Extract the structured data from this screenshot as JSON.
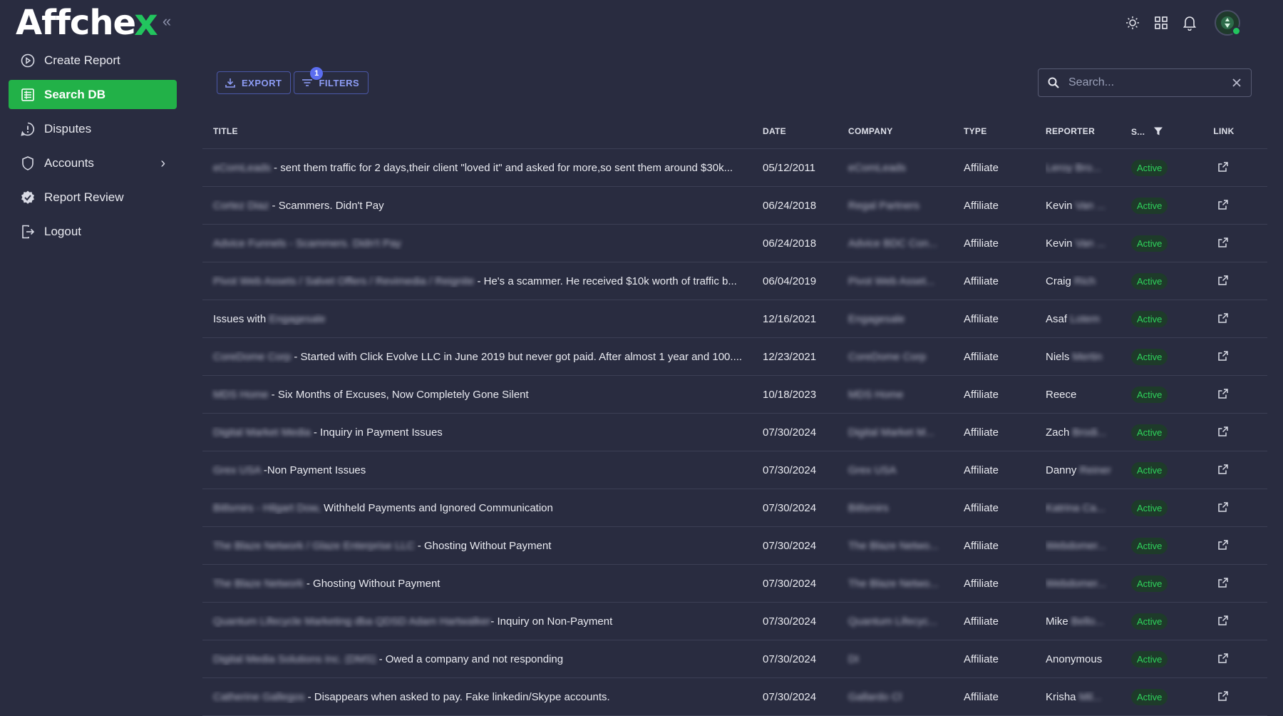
{
  "brand": {
    "logo_text": "Affche",
    "logo_x": "x",
    "collapse_icon": "«"
  },
  "sidebar": {
    "items": [
      {
        "label": "Create Report",
        "icon": "play-circle-icon"
      },
      {
        "label": "Search DB",
        "icon": "table-list-icon",
        "active": true
      },
      {
        "label": "Disputes",
        "icon": "alert-circle-icon"
      },
      {
        "label": "Accounts",
        "icon": "shield-icon",
        "has_chevron": true
      },
      {
        "label": "Report Review",
        "icon": "verified-badge-icon"
      },
      {
        "label": "Logout",
        "icon": "logout-icon"
      }
    ],
    "chevron": "›"
  },
  "topbar": {
    "icons": [
      "sun-icon",
      "grid-icon",
      "bell-icon",
      "avatar"
    ]
  },
  "toolbar": {
    "export_label": "EXPORT",
    "filters_label": "FILTERS",
    "filters_count": "1"
  },
  "search": {
    "placeholder": "Search...",
    "value": ""
  },
  "table": {
    "headers": {
      "title": "TITLE",
      "date": "DATE",
      "company": "COMPANY",
      "type": "TYPE",
      "reporter": "REPORTER",
      "status": "S...",
      "link": "LINK"
    },
    "rows": [
      {
        "title_blur": "eComLeads",
        "title": " - sent them traffic for 2 days,their client \"loved it\" and asked for more,so sent them around $30k...",
        "date": "05/12/2011",
        "company": "eComLeads",
        "type": "Affiliate",
        "reporter": "",
        "reporter_blur": "Leroy Bro...",
        "status": "Active"
      },
      {
        "title_blur": "Cortez Diaz",
        "title": " - Scammers. Didn't Pay",
        "date": "06/24/2018",
        "company": "Regal Partners",
        "type": "Affiliate",
        "reporter": "Kevin ",
        "reporter_blur": "Van ...",
        "status": "Active"
      },
      {
        "title_blur": "Advice Funnels - Scammers. Didn't Pay",
        "title": "",
        "date": "06/24/2018",
        "company": "Advice BDC Con...",
        "type": "Affiliate",
        "reporter": "Kevin ",
        "reporter_blur": "Van ...",
        "status": "Active"
      },
      {
        "title_blur": "Pivot Web Assets / Salvet Offers / Revimedia / Reignite",
        "title": " - He's a scammer. He received $10k worth of traffic b...",
        "date": "06/04/2019",
        "company": "Pivot Web Asset...",
        "type": "Affiliate",
        "reporter": "Craig ",
        "reporter_blur": "Rich",
        "status": "Active"
      },
      {
        "title_blur": "",
        "title": "Issues with ",
        "title_tail_blur": "Engagesale",
        "date": "12/16/2021",
        "company": "Engagesale",
        "type": "Affiliate",
        "reporter": "Asaf ",
        "reporter_blur": "Lotem",
        "status": "Active"
      },
      {
        "title_blur": "CoreDome Corp",
        "title": " - Started with Click Evolve LLC in June 2019 but never got paid. After almost 1 year and 100....",
        "date": "12/23/2021",
        "company": "CoreDome Corp",
        "type": "Affiliate",
        "reporter": "Niels ",
        "reporter_blur": "Mertin",
        "status": "Active"
      },
      {
        "title_blur": "MDS Home",
        "title": " - Six Months of Excuses, Now Completely Gone Silent",
        "date": "10/18/2023",
        "company": "MDS Home",
        "type": "Affiliate",
        "reporter": "Reece",
        "reporter_blur": "",
        "status": "Active"
      },
      {
        "title_blur": "Digital Market Media",
        "title": " - Inquiry in Payment Issues",
        "date": "07/30/2024",
        "company": "Digital Market M...",
        "type": "Affiliate",
        "reporter": "Zach ",
        "reporter_blur": "Brodi...",
        "status": "Active"
      },
      {
        "title_blur": "Grex USA",
        "title": " -Non Payment Issues",
        "date": "07/30/2024",
        "company": "Grex USA",
        "type": "Affiliate",
        "reporter": "Danny ",
        "reporter_blur": "Reiner",
        "status": "Active"
      },
      {
        "title_blur": "Bitlsmirs - Hilgart Dow,",
        "title": " Withheld Payments and Ignored Communication",
        "date": "07/30/2024",
        "company": "Bitlsmirs",
        "type": "Affiliate",
        "reporter": "",
        "reporter_blur": "Katrina Ca...",
        "status": "Active"
      },
      {
        "title_blur": "The Blaze Network / Glaze Enterprise LLC",
        "title": " - Ghosting Without Payment",
        "date": "07/30/2024",
        "company": "The Blaze Netwo...",
        "type": "Affiliate",
        "reporter": "",
        "reporter_blur": "Webdomer...",
        "status": "Active"
      },
      {
        "title_blur": "The Blaze Network",
        "title": " - Ghosting Without Payment",
        "date": "07/30/2024",
        "company": "The Blaze Netwo...",
        "type": "Affiliate",
        "reporter": "",
        "reporter_blur": "Webdomer...",
        "status": "Active"
      },
      {
        "title_blur": "Quantum Lifecycle Marketing dba QDSD Adam Hartwalker",
        "title": "- Inquiry on Non-Payment",
        "date": "07/30/2024",
        "company": "Quantum Lifecyc...",
        "type": "Affiliate",
        "reporter": "Mike ",
        "reporter_blur": "Bello...",
        "status": "Active"
      },
      {
        "title_blur": "Digital Media Solutions Inc. (DMS)",
        "title": " - Owed a company and not responding",
        "date": "07/30/2024",
        "company": "DI",
        "type": "Affiliate",
        "reporter": "Anonymous",
        "reporter_blur": "",
        "status": "Active"
      },
      {
        "title_blur": "Catherine Gallegos",
        "title": " - Disappears when asked to pay. Fake linkedin/Skype accounts.",
        "date": "07/30/2024",
        "company": "Gallardo Cl",
        "type": "Affiliate",
        "reporter": "Krisha ",
        "reporter_blur": "Mil...",
        "status": "Active"
      }
    ]
  }
}
